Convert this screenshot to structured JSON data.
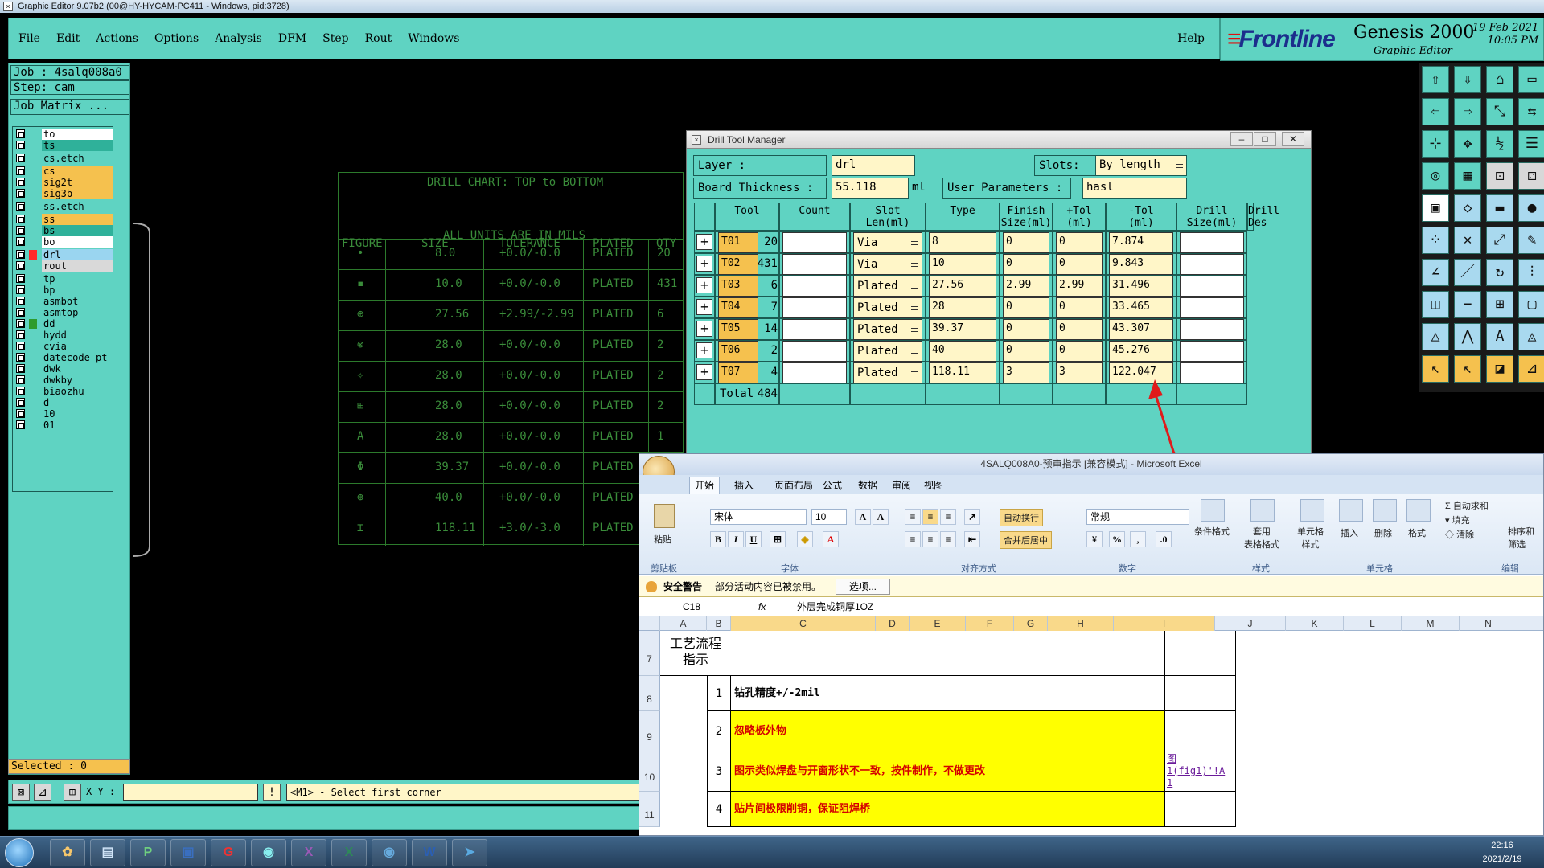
{
  "titlebar": {
    "text": "Graphic Editor 9.07b2 (00@HY-HYCAM-PC411 - Windows, pid:3728)"
  },
  "menu": [
    "File",
    "Edit",
    "Actions",
    "Options",
    "Analysis",
    "DFM",
    "Step",
    "Rout",
    "Windows"
  ],
  "menu_help": "Help",
  "brand": {
    "logo": "Frontline",
    "product": "Genesis 2000",
    "subtitle": "Graphic Editor",
    "date": "19 Feb 2021",
    "time": "10:05 PM"
  },
  "left_panel": {
    "job": "Job : 4salq008a0",
    "step": "Step: cam",
    "job_matrix": "Job Matrix ...",
    "selected": "Selected : 0"
  },
  "layers": [
    {
      "name": "to",
      "color": "#ffffff"
    },
    {
      "name": "ts",
      "color": "#2fb19a"
    },
    {
      "name": "cs.etch",
      "color": "#5fd3c2"
    },
    {
      "name": "cs",
      "color": "#f5c14e"
    },
    {
      "name": "sig2t",
      "color": "#f5c14e"
    },
    {
      "name": "sig3b",
      "color": "#f5c14e"
    },
    {
      "name": "ss.etch",
      "color": "#5fd3c2"
    },
    {
      "name": "ss",
      "color": "#f5c14e"
    },
    {
      "name": "bs",
      "color": "#2fb19a"
    },
    {
      "name": "bo",
      "color": "#ffffff"
    },
    {
      "name": "drl",
      "color": "#9ad5f0"
    },
    {
      "name": "rout",
      "color": "#d9d9d9"
    },
    {
      "name": "tp",
      "color": "#5fd3c2"
    },
    {
      "name": "bp",
      "color": "#5fd3c2"
    },
    {
      "name": "asmbot",
      "color": "#5fd3c2"
    },
    {
      "name": "asmtop",
      "color": "#5fd3c2"
    },
    {
      "name": "dd",
      "color": "#5fd3c2"
    },
    {
      "name": "hydd",
      "color": "#5fd3c2"
    },
    {
      "name": "cvia",
      "color": "#5fd3c2"
    },
    {
      "name": "datecode-pt",
      "color": "#5fd3c2"
    },
    {
      "name": "dwk",
      "color": "#5fd3c2"
    },
    {
      "name": "dwkby",
      "color": "#5fd3c2"
    },
    {
      "name": "biaozhu",
      "color": "#5fd3c2"
    },
    {
      "name": "d",
      "color": "#5fd3c2"
    },
    {
      "name": "10",
      "color": "#5fd3c2"
    },
    {
      "name": "01",
      "color": "#5fd3c2"
    }
  ],
  "bottom_bar": {
    "xy_label": "X Y :",
    "xy_value": "",
    "prompt": "<M1> - Select first corner"
  },
  "drill_chart": {
    "title": "DRILL CHART: TOP to BOTTOM",
    "units": "ALL UNITS ARE IN MILS",
    "headers": [
      "FIGURE",
      "SIZE",
      "TOLERANCE",
      "PLATED",
      "QTY"
    ],
    "rows": [
      {
        "fig": "•",
        "size": "8.0",
        "tol": "+0.0/-0.0",
        "plated": "PLATED",
        "qty": "20"
      },
      {
        "fig": "▪",
        "size": "10.0",
        "tol": "+0.0/-0.0",
        "plated": "PLATED",
        "qty": "431"
      },
      {
        "fig": "⊕",
        "size": "27.56",
        "tol": "+2.99/-2.99",
        "plated": "PLATED",
        "qty": "6"
      },
      {
        "fig": "⊗",
        "size": "28.0",
        "tol": "+0.0/-0.0",
        "plated": "PLATED",
        "qty": "2"
      },
      {
        "fig": "✧",
        "size": "28.0",
        "tol": "+0.0/-0.0",
        "plated": "PLATED",
        "qty": "2"
      },
      {
        "fig": "⊞",
        "size": "28.0",
        "tol": "+0.0/-0.0",
        "plated": "PLATED",
        "qty": "2"
      },
      {
        "fig": "A",
        "size": "28.0",
        "tol": "+0.0/-0.0",
        "plated": "PLATED",
        "qty": "1"
      },
      {
        "fig": "Φ",
        "size": "39.37",
        "tol": "+0.0/-0.0",
        "plated": "PLATED",
        "qty": ""
      },
      {
        "fig": "⊛",
        "size": "40.0",
        "tol": "+0.0/-0.0",
        "plated": "PLATED",
        "qty": ""
      },
      {
        "fig": "⌶",
        "size": "118.11",
        "tol": "+3.0/-3.0",
        "plated": "PLATED",
        "qty": ""
      }
    ]
  },
  "drill_tool_manager": {
    "title": "Drill Tool Manager",
    "layer_label": "Layer          :",
    "layer_value": "drl",
    "slots_label": "Slots:",
    "slots_value": "By length",
    "board_thickness_label": "Board Thickness :",
    "board_thickness_value": "55.118",
    "board_thickness_unit": "ml",
    "user_params_label": "User Parameters :",
    "user_params_value": "hasl",
    "headers": [
      "Tool",
      "Count",
      "Slot\nLen(ml)",
      "Type",
      "Finish\nSize(ml)",
      "+Tol\n(ml)",
      "-Tol\n(ml)",
      "Drill\nSize(ml)",
      "Drill\nDes"
    ],
    "tools": [
      {
        "tool": "T01",
        "count": "20",
        "type": "Via",
        "finish": "8",
        "ptol": "0",
        "mtol": "0",
        "drill": "7.874"
      },
      {
        "tool": "T02",
        "count": "431",
        "type": "Via",
        "finish": "10",
        "ptol": "0",
        "mtol": "0",
        "drill": "9.843"
      },
      {
        "tool": "T03",
        "count": "6",
        "type": "Plated",
        "finish": "27.56",
        "ptol": "2.99",
        "mtol": "2.99",
        "drill": "31.496"
      },
      {
        "tool": "T04",
        "count": "7",
        "type": "Plated",
        "finish": "28",
        "ptol": "0",
        "mtol": "0",
        "drill": "33.465"
      },
      {
        "tool": "T05",
        "count": "14",
        "type": "Plated",
        "finish": "39.37",
        "ptol": "0",
        "mtol": "0",
        "drill": "43.307"
      },
      {
        "tool": "T06",
        "count": "2",
        "type": "Plated",
        "finish": "40",
        "ptol": "0",
        "mtol": "0",
        "drill": "45.276"
      },
      {
        "tool": "T07",
        "count": "4",
        "type": "Plated",
        "finish": "118.11",
        "ptol": "3",
        "mtol": "3",
        "drill": "122.047"
      }
    ],
    "total_label": "Total",
    "total_count": "484"
  },
  "excel": {
    "title": "4SALQ008A0-预审指示 [兼容模式] - Microsoft Excel",
    "tabs": [
      "开始",
      "插入",
      "页面布局",
      "公式",
      "数据",
      "审阅",
      "视图"
    ],
    "ribbon": {
      "paste": "粘贴",
      "clipboard": "剪贴板",
      "font_name": "宋体",
      "font_size": "10",
      "font_group": "字体",
      "wrap": "自动换行",
      "merge": "合并后居中",
      "align_group": "对齐方式",
      "num_format": "常规",
      "number_group": "数字",
      "cond_format": "条件格式",
      "table_format": "套用\n表格格式",
      "cell_style": "单元格\n样式",
      "style_group": "样式",
      "insert": "插入",
      "delete": "删除",
      "format": "格式",
      "cells_group": "单元格",
      "autosum": "自动求和",
      "fill": "填充",
      "clear": "清除",
      "sort": "排序和\n筛选",
      "edit_group": "编辑"
    },
    "security_label": "安全警告",
    "security_msg": "部分活动内容已被禁用。",
    "security_btn": "选项...",
    "name_box": "C18",
    "formula": "外层完成铜厚1OZ",
    "columns": [
      "A",
      "B",
      "C",
      "D",
      "E",
      "F",
      "G",
      "H",
      "I",
      "J",
      "K",
      "L",
      "M",
      "N"
    ],
    "row_numbers": [
      "7",
      "8",
      "9",
      "10",
      "11"
    ],
    "header_cell": "工艺流程\n指示",
    "rows": [
      {
        "num": "1",
        "text": "钻孔精度+/-2mil",
        "color": "#000000",
        "bg": "#ffffff"
      },
      {
        "num": "2",
        "text": "忽略板外物",
        "color": "#d40000",
        "bg": "#ffff00"
      },
      {
        "num": "3",
        "text": "图示类似焊盘与开窗形状不一致，按件制作，不做更改",
        "color": "#d40000",
        "bg": "#ffff00"
      },
      {
        "num": "4",
        "text": "贴片间极限削铜，保证阻焊桥",
        "color": "#d40000",
        "bg": "#ffff00"
      }
    ],
    "link_cell": "图\n1(fig1)'!A\n1"
  },
  "taskbar": {
    "apps": [
      "✿",
      "▤",
      "P",
      "▣",
      "G",
      "◉",
      "X",
      "X",
      "◉",
      "W",
      "➤"
    ],
    "time": "22:16",
    "date": "2021/2/19"
  }
}
